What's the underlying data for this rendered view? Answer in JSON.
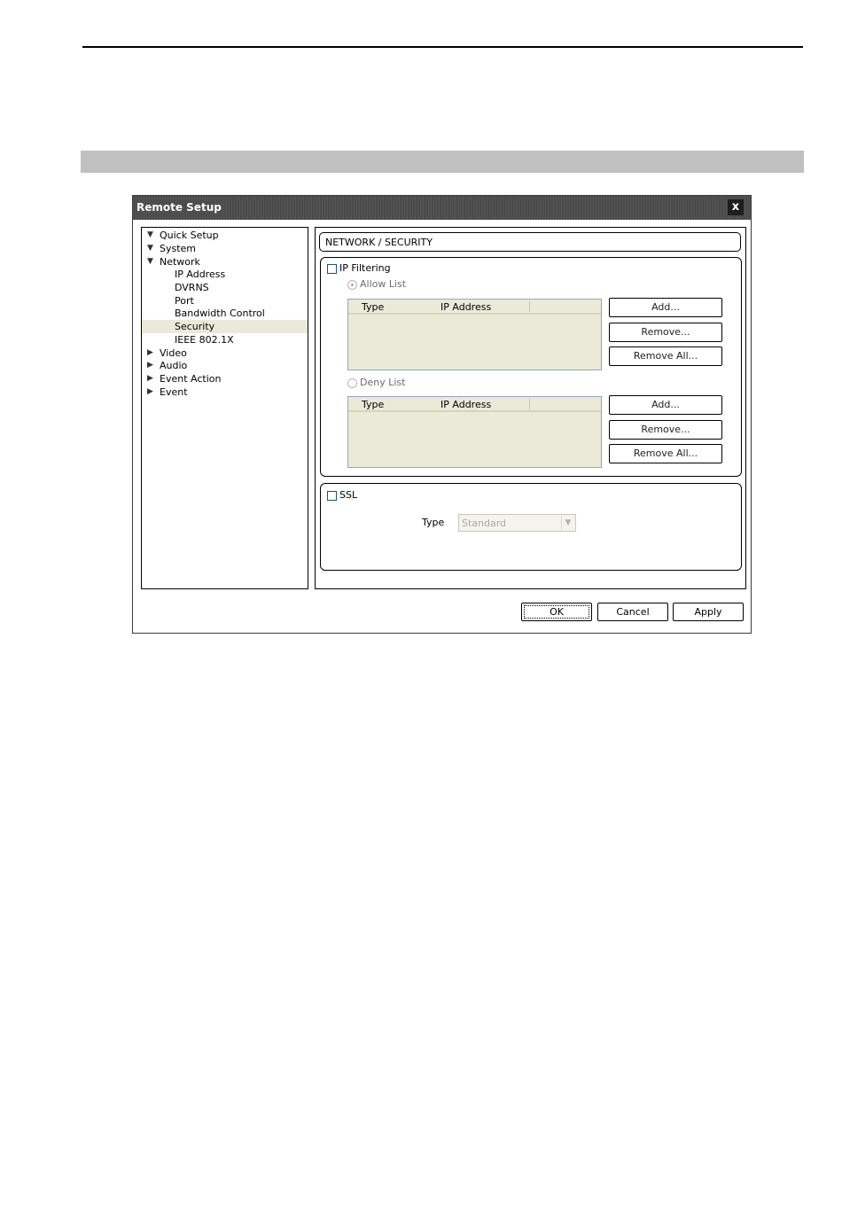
{
  "dialog": {
    "title": "Remote Setup",
    "close_glyph": "x"
  },
  "tree": {
    "items": [
      {
        "label": "Quick Setup",
        "expander": "▼"
      },
      {
        "label": "System",
        "expander": "▼"
      },
      {
        "label": "Network",
        "expander": "▼"
      },
      {
        "label": "IP Address"
      },
      {
        "label": "DVRNS"
      },
      {
        "label": "Port"
      },
      {
        "label": "Bandwidth Control"
      },
      {
        "label": "Security",
        "selected": true
      },
      {
        "label": "IEEE 802.1X"
      },
      {
        "label": "Video",
        "expander": "▶"
      },
      {
        "label": "Audio",
        "expander": "▶"
      },
      {
        "label": "Event Action",
        "expander": "▶"
      },
      {
        "label": "Event",
        "expander": "▶"
      }
    ]
  },
  "panel": {
    "header": "NETWORK / SECURITY",
    "ip_filtering": {
      "label": "IP Filtering",
      "checked": false,
      "allow_list": {
        "label": "Allow List",
        "selected": true,
        "columns": [
          "Type",
          "IP Address"
        ],
        "buttons": {
          "add": "Add...",
          "remove": "Remove...",
          "remove_all": "Remove All..."
        }
      },
      "deny_list": {
        "label": "Deny List",
        "selected": false,
        "columns": [
          "Type",
          "IP Address"
        ],
        "buttons": {
          "add": "Add...",
          "remove": "Remove...",
          "remove_all": "Remove All..."
        }
      }
    },
    "ssl": {
      "label": "SSL",
      "checked": false,
      "type_label": "Type",
      "type_value": "Standard"
    }
  },
  "footer": {
    "ok": "OK",
    "cancel": "Cancel",
    "apply": "Apply"
  },
  "colors": {
    "titlebar": "#505050",
    "selected_row": "#ebe9dc",
    "list_background": "#ebe9d8",
    "section_bar": "#c0c0c0"
  },
  "icons": {
    "expanded": "chevron-down-icon",
    "collapsed": "chevron-right-icon",
    "close": "close-icon",
    "dropdown": "chevron-down-icon"
  }
}
